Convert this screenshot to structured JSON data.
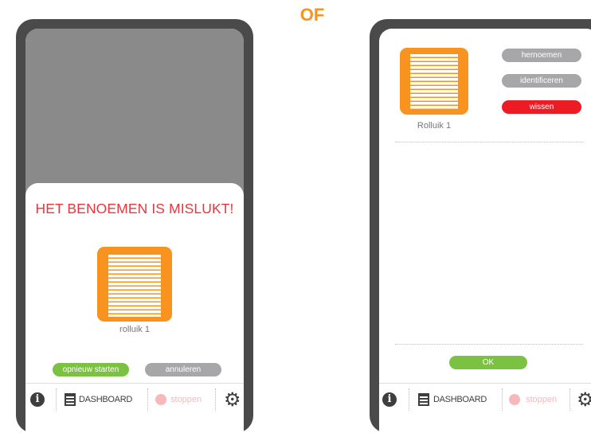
{
  "separator": {
    "label": "OF"
  },
  "left_screen": {
    "dialog_title": "HET BENOEMEN IS MISLUKT!",
    "device_label": "rolluik 1",
    "retry_label": "opnieuw starten",
    "cancel_label": "annuleren"
  },
  "right_screen": {
    "device_label": "Rolluik 1",
    "rename_label": "hernoemen",
    "identify_label": "identificeren",
    "delete_label": "wissen",
    "ok_label": "OK"
  },
  "navbar": {
    "info_symbol": "i",
    "dashboard_label": "DASHBOARD",
    "stop_label": "stoppen",
    "settings_symbol": "⚙"
  },
  "colors": {
    "accent_orange": "#f7931e",
    "error_red": "#e8373e",
    "delete_red": "#ed1c24",
    "confirm_green": "#7cc242",
    "neutral_grey": "#a7a7aa",
    "stop_pink": "#f7b8bb",
    "phone_frame": "#4a4a4a"
  },
  "icons": [
    "info-icon",
    "dashboard-icon",
    "stop-icon",
    "gear-icon",
    "roller-shutter-icon"
  ]
}
